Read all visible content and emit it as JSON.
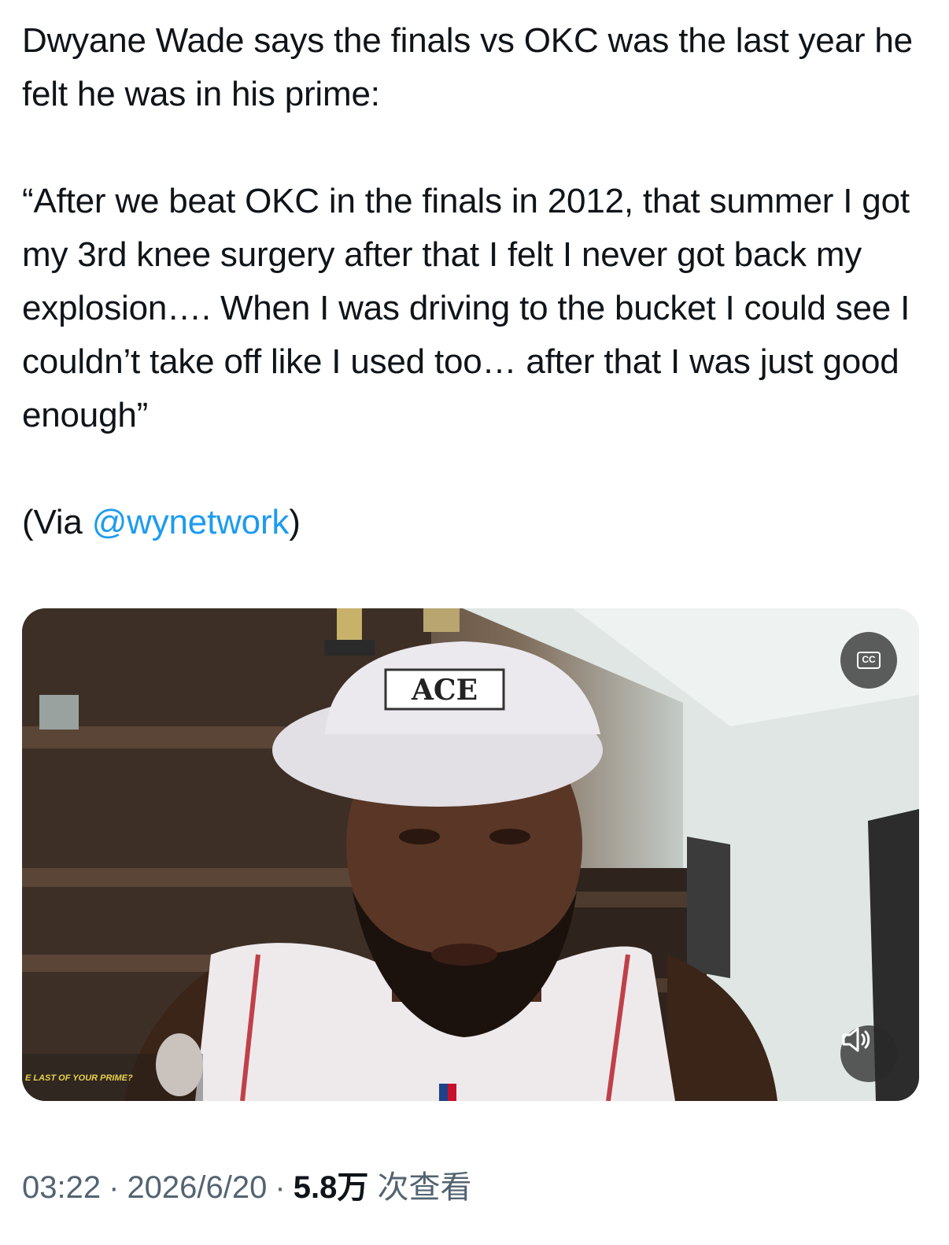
{
  "tweet": {
    "text_line1": "Dwyane Wade says the finals vs OKC was the last year he felt he was in his prime:",
    "quote": "“After we beat OKC in the finals in 2012, that summer I got my 3rd knee surgery after that I felt I never got back my explosion…. When I was driving to the bucket I could see I couldn’t take off like I used too… after that I was just good enough”",
    "via_prefix": "(Via ",
    "via_mention": "@wynetwork",
    "via_suffix": ")"
  },
  "media": {
    "cc_label": "CC",
    "cc_icon": "closed-captions-icon",
    "volume_icon": "speaker-icon",
    "cap_text": "ACE",
    "thumb_caption": "E LAST OF YOUR PRIME?"
  },
  "meta": {
    "time": "03:22",
    "date": "2026/6/20",
    "views_value": "5.8万",
    "views_label": "次查看",
    "separator": "·"
  },
  "colors": {
    "text": "#0f1419",
    "secondary": "#536471",
    "link": "#1d9bf0"
  }
}
